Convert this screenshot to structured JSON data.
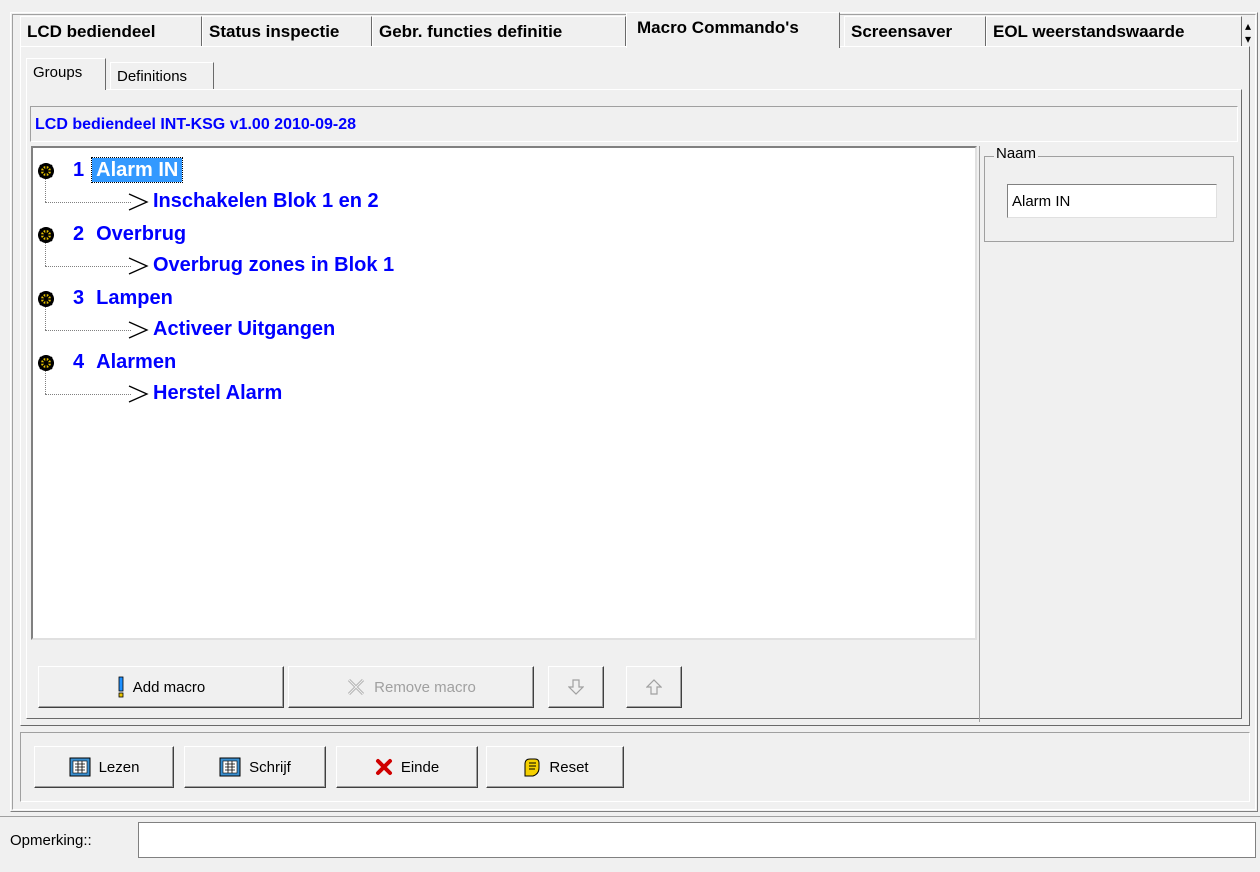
{
  "main_tabs": [
    {
      "label": "LCD bediendeel"
    },
    {
      "label": "Status inspectie"
    },
    {
      "label": "Gebr. functies definitie"
    },
    {
      "label": "Macro Commando's"
    },
    {
      "label": "Screensaver"
    },
    {
      "label": "EOL weerstandswaarde"
    }
  ],
  "sub_tabs": [
    {
      "label": "Groups"
    },
    {
      "label": "Definitions"
    }
  ],
  "header_text": "LCD bediendeel INT-KSG v1.00 2010-09-28",
  "groups": [
    {
      "num": "1",
      "name": "Alarm IN",
      "macro": "Inschakelen Blok 1 en 2"
    },
    {
      "num": "2",
      "name": "Overbrug",
      "macro": "Overbrug zones in Blok 1"
    },
    {
      "num": "3",
      "name": "Lampen",
      "macro": "Activeer Uitgangen"
    },
    {
      "num": "4",
      "name": "Alarmen",
      "macro": "Herstel Alarm"
    }
  ],
  "naam": {
    "label": "Naam",
    "value": "Alarm IN"
  },
  "macro_buttons": {
    "add": "Add macro",
    "remove": "Remove macro"
  },
  "command_buttons": {
    "lezen": "Lezen",
    "schrijf": "Schrijf",
    "einde": "Einde",
    "reset": "Reset"
  },
  "opmerking_label": "Opmerking::",
  "colors": {
    "accent": "#0000ff",
    "selection": "#3399ff"
  }
}
